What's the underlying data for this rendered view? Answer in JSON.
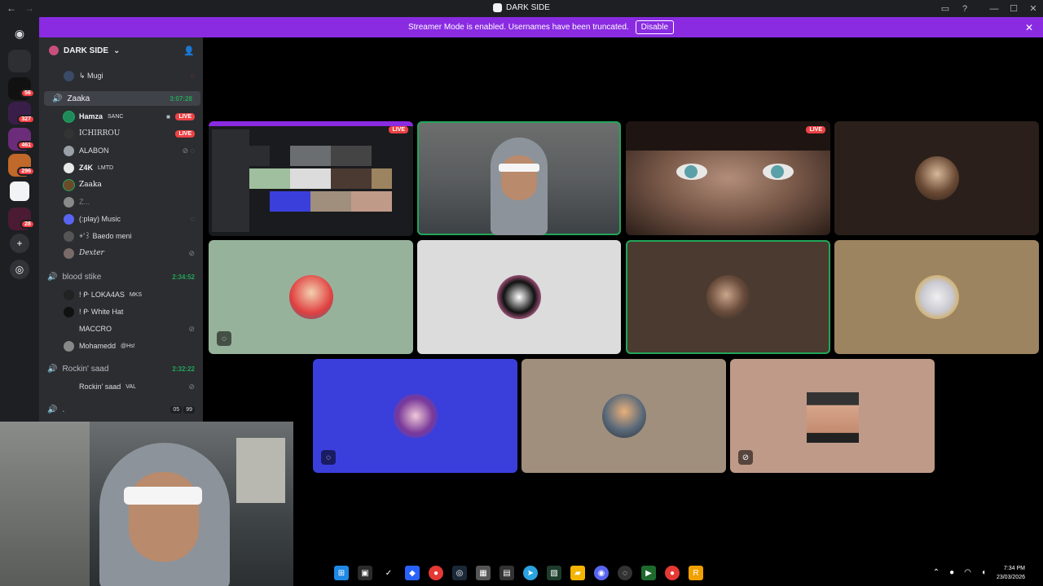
{
  "window": {
    "title": "DARK SIDE"
  },
  "banner": {
    "message": "Streamer Mode is enabled. Usernames have been truncated.",
    "disable_label": "Disable"
  },
  "rail": {
    "badges": [
      "56",
      "327",
      "461",
      "296",
      "28"
    ]
  },
  "server": {
    "name": "DARK SIDE"
  },
  "sidebar": {
    "top_user": "↳ Mugi",
    "channels": [
      {
        "name": "Zaaka",
        "timer": "3:07:28"
      },
      {
        "name": "blood stike",
        "timer": "2:34:52"
      },
      {
        "name": "Rockin' saad",
        "timer": "2:32:22"
      },
      {
        "name": "."
      }
    ],
    "zaaka_users": [
      {
        "name": "Hamza",
        "tag": "SANC",
        "live": "LIVE"
      },
      {
        "name": "ICHIRROU",
        "live": "LIVE"
      },
      {
        "name": "ALABON"
      },
      {
        "name": "Z4K",
        "tag": "LMTD"
      },
      {
        "name": "Zaaka"
      },
      {
        "name": "Z..."
      },
      {
        "name": "(:play) Music"
      },
      {
        "name": "+'꒱ Baedo meni"
      },
      {
        "name": "Dexter"
      }
    ],
    "blood_users": [
      {
        "name": "! ᑷ LOKA4AS",
        "tag": "MKS"
      },
      {
        "name": "! ᑷ White Hat"
      },
      {
        "name": "MACCRO"
      },
      {
        "name": "Mohamedd",
        "tag": "@Hs!"
      }
    ],
    "rockin_users": [
      {
        "name": "Rockin' saad",
        "tag": "VAL"
      }
    ],
    "last_counts": [
      "05",
      "99"
    ]
  },
  "tiles": {
    "live_label": "LIVE"
  },
  "taskbar": {
    "time": "7:34 PM",
    "date": "23/03/2026"
  },
  "colors": {
    "accent": "#8a2be2",
    "speaking": "#23a55a",
    "live": "#ed4245"
  }
}
